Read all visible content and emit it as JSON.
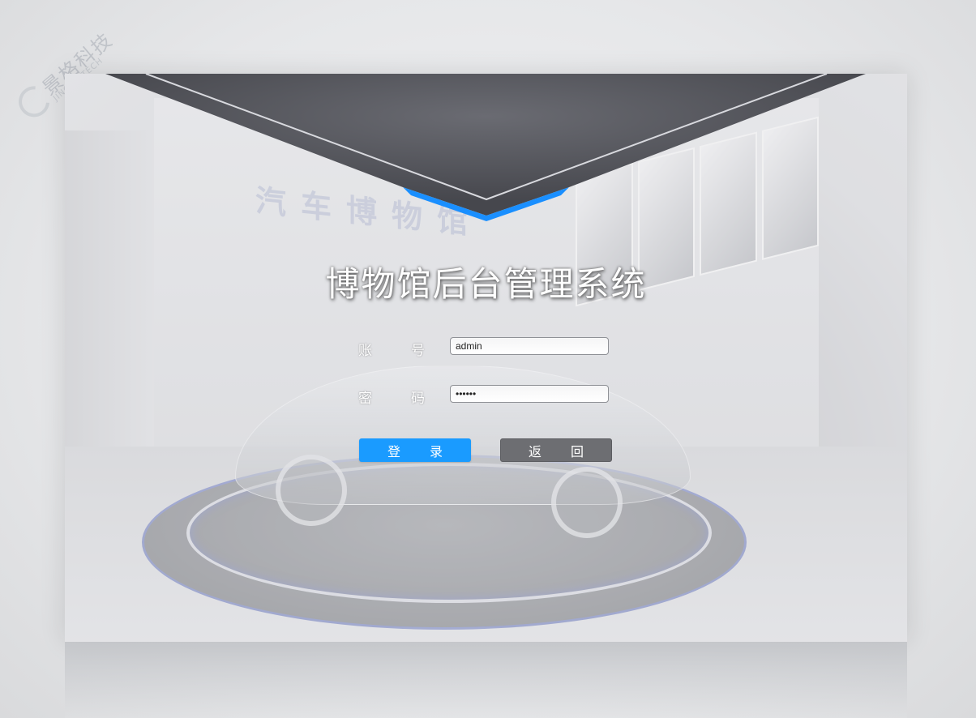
{
  "watermark": {
    "brand_cn": "景格科技",
    "brand_en": "JINGGE TECH"
  },
  "scene": {
    "wall_sign": "汽车博物馆"
  },
  "login": {
    "title": "博物馆后台管理系统",
    "account_label_1": "账",
    "account_label_2": "号",
    "account_value": "admin",
    "password_label_1": "密",
    "password_label_2": "码",
    "password_value": "••••••",
    "login_button_1": "登",
    "login_button_2": "录",
    "back_button_1": "返",
    "back_button_2": "回"
  },
  "colors": {
    "primary_button": "#1a9bff",
    "secondary_button": "#6d6e72",
    "banner_dark": "#4e4f55",
    "banner_accent": "#1a8fff"
  }
}
